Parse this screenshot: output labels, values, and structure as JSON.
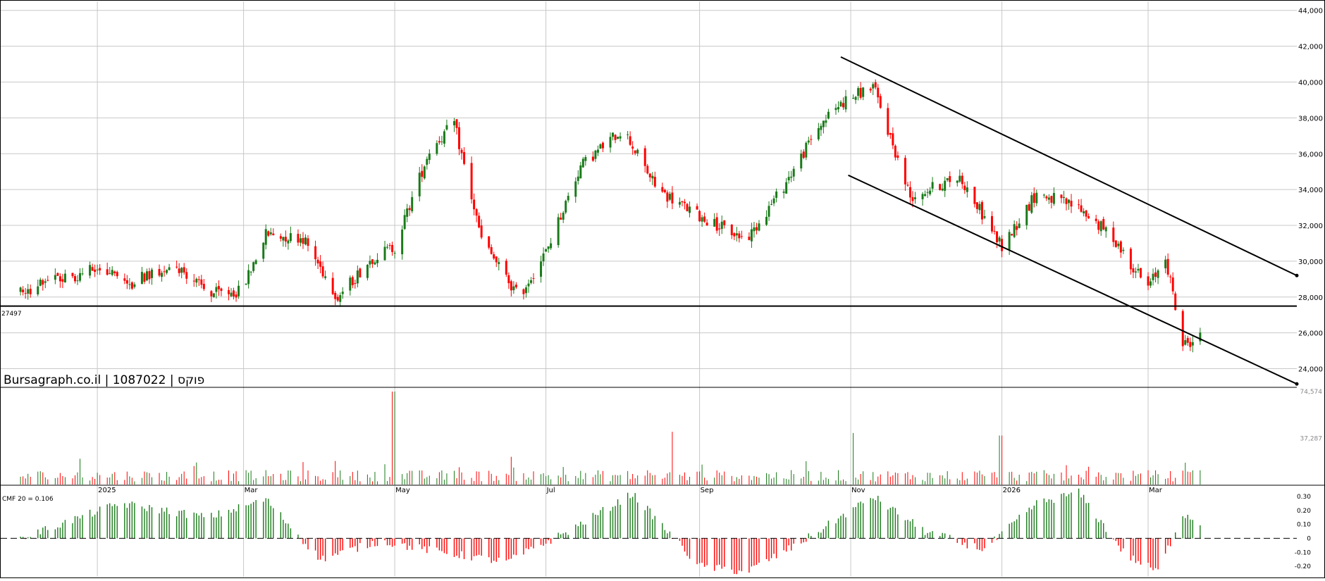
{
  "watermark": "Bursagraph.co.il | 1087022 | פוקס",
  "support_label": "27497",
  "cmf_label": "CMF 20 = 0.106",
  "price_axis": {
    "ticks": [
      24000,
      26000,
      28000,
      30000,
      32000,
      34000,
      36000,
      38000,
      40000,
      42000,
      44000
    ],
    "labels": [
      "24,000",
      "26,000",
      "28,000",
      "30,000",
      "32,000",
      "34,000",
      "36,000",
      "38,000",
      "40,000",
      "42,000",
      "44,000"
    ]
  },
  "volume_axis": {
    "labels": [
      "74,574",
      "37,287"
    ],
    "values": [
      74574,
      37287
    ]
  },
  "cmf_axis": {
    "values": [
      0.3,
      0.2,
      0.1,
      0,
      -0.1,
      -0.2
    ],
    "labels": [
      "0.30",
      "0.20",
      "0.10",
      "0",
      "-0.10",
      "-0.20"
    ]
  },
  "time_axis": {
    "labels": [
      "2025",
      "Mar",
      "May",
      "Jul",
      "Sep",
      "Nov",
      "2026",
      "Mar"
    ]
  },
  "colors": {
    "up": "#1a7a1a",
    "down": "#ff0000",
    "grid": "#c8c8c8",
    "line": "#000000"
  },
  "chart_data": {
    "type": "candlestick",
    "title": "",
    "period": "2024-12 to 2026-03",
    "grid": true,
    "support_level": 27497,
    "price_ylim": [
      23000,
      44500
    ],
    "price_points": [
      {
        "date": "2024-12-01",
        "close": 28300
      },
      {
        "date": "2024-12-15",
        "close": 28900
      },
      {
        "date": "2025-01-01",
        "close": 29600
      },
      {
        "date": "2025-01-15",
        "close": 28800
      },
      {
        "date": "2025-02-01",
        "close": 29900
      },
      {
        "date": "2025-02-15",
        "close": 28200
      },
      {
        "date": "2025-02-28",
        "close": 28300
      },
      {
        "date": "2025-03-10",
        "close": 31500
      },
      {
        "date": "2025-03-25",
        "close": 31300
      },
      {
        "date": "2025-04-08",
        "close": 28000
      },
      {
        "date": "2025-04-22",
        "close": 30200
      },
      {
        "date": "2025-05-01",
        "close": 30800
      },
      {
        "date": "2025-05-15",
        "close": 36200
      },
      {
        "date": "2025-05-25",
        "close": 37700
      },
      {
        "date": "2025-06-05",
        "close": 31200
      },
      {
        "date": "2025-06-20",
        "close": 28000
      },
      {
        "date": "2025-07-01",
        "close": 30500
      },
      {
        "date": "2025-07-15",
        "close": 35300
      },
      {
        "date": "2025-08-01",
        "close": 37400
      },
      {
        "date": "2025-08-15",
        "close": 34000
      },
      {
        "date": "2025-09-01",
        "close": 32500
      },
      {
        "date": "2025-09-20",
        "close": 31200
      },
      {
        "date": "2025-10-05",
        "close": 34200
      },
      {
        "date": "2025-10-20",
        "close": 37700
      },
      {
        "date": "2025-10-28",
        "close": 38800
      },
      {
        "date": "2025-11-10",
        "close": 39800
      },
      {
        "date": "2025-11-25",
        "close": 33600
      },
      {
        "date": "2025-12-15",
        "close": 34700
      },
      {
        "date": "2026-01-01",
        "close": 30800
      },
      {
        "date": "2026-01-15",
        "close": 33800
      },
      {
        "date": "2026-02-01",
        "close": 33000
      },
      {
        "date": "2026-02-15",
        "close": 31300
      },
      {
        "date": "2026-03-01",
        "close": 28500
      },
      {
        "date": "2026-03-08",
        "close": 30300
      },
      {
        "date": "2026-03-15",
        "close": 25300
      },
      {
        "date": "2026-03-22",
        "close": 25800
      }
    ],
    "trend_channel": {
      "upper": [
        {
          "date": "2025-10-28",
          "value": 41400
        },
        {
          "date": "2026-04-30",
          "value": 29200
        }
      ],
      "lower": [
        {
          "date": "2025-10-31",
          "value": 34800
        },
        {
          "date": "2026-04-30",
          "value": 23150
        }
      ]
    },
    "volume_ylim": [
      0,
      74574
    ],
    "volume_points": [
      {
        "date": "2025-05-01",
        "value": 74000
      },
      {
        "date": "2025-08-22",
        "value": 42000
      },
      {
        "date": "2025-11-01",
        "value": 41000
      },
      {
        "date": "2026-01-01",
        "value": 39000
      }
    ],
    "cmf_ylim": [
      -0.25,
      0.35
    ],
    "cmf_points": [
      {
        "date": "2024-12-01",
        "value": 0
      },
      {
        "date": "2025-01-10",
        "value": 0.25
      },
      {
        "date": "2025-02-15",
        "value": 0.15
      },
      {
        "date": "2025-03-10",
        "value": 0.28
      },
      {
        "date": "2025-04-01",
        "value": -0.15
      },
      {
        "date": "2025-04-25",
        "value": -0.02
      },
      {
        "date": "2025-05-20",
        "value": -0.1
      },
      {
        "date": "2025-06-15",
        "value": -0.17
      },
      {
        "date": "2025-07-10",
        "value": 0.05
      },
      {
        "date": "2025-08-05",
        "value": 0.32
      },
      {
        "date": "2025-09-01",
        "value": -0.2
      },
      {
        "date": "2025-09-20",
        "value": -0.24
      },
      {
        "date": "2025-10-10",
        "value": -0.05
      },
      {
        "date": "2025-11-10",
        "value": 0.3
      },
      {
        "date": "2025-12-01",
        "value": 0.05
      },
      {
        "date": "2025-12-25",
        "value": -0.08
      },
      {
        "date": "2026-01-15",
        "value": 0.25
      },
      {
        "date": "2026-02-01",
        "value": 0.33
      },
      {
        "date": "2026-02-20",
        "value": -0.12
      },
      {
        "date": "2026-03-05",
        "value": -0.24
      },
      {
        "date": "2026-03-15",
        "value": 0.18
      },
      {
        "date": "2026-03-22",
        "value": 0.11
      }
    ]
  }
}
